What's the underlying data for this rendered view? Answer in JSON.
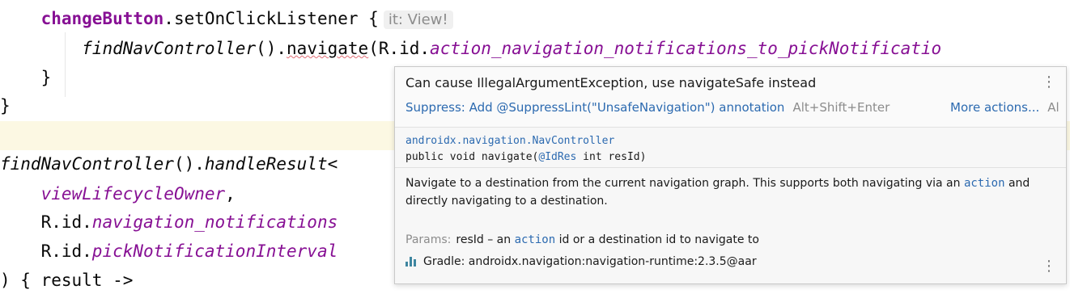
{
  "code": {
    "line1": {
      "receiver": "changeButton",
      "call": ".setOnClickListener {",
      "hint": "it: View!"
    },
    "line2": {
      "fn": "findNavController",
      "pre": "().",
      "method": "navigate",
      "open": "(R.id.",
      "arg": "action_navigation_notifications_to_pickNotificatio"
    },
    "line3": "}",
    "line4": "}",
    "line6": {
      "fn": "findNavController",
      "mid": "().",
      "method": "handleResult",
      "tail": "<"
    },
    "line7": {
      "arg": "viewLifecycleOwner",
      "tail": ","
    },
    "line8": {
      "pre": "R.id.",
      "arg": "navigation_notifications"
    },
    "line9": {
      "pre": "R.id.",
      "arg": "pickNotificationInterval"
    },
    "line10": ") { result ->"
  },
  "popup": {
    "message": "Can cause IllegalArgumentException, use navigateSafe instead",
    "suppress_label": "Suppress: Add @SuppressLint(\"UnsafeNavigation\") annotation",
    "suppress_shortcut": "Alt+Shift+Enter",
    "more_actions": "More actions...",
    "more_shortcut": "Al",
    "menu_glyph": "⋮",
    "signature": {
      "package": "androidx.navigation.NavController",
      "decl_pre": "public void navigate(",
      "annotation": "@IdRes",
      "decl_post": " int resId)"
    },
    "doc": {
      "text1": "Navigate to a destination from the current navigation graph. This supports both navigating via an ",
      "code": "action",
      "text2": " and directly navigating to a destination."
    },
    "params": {
      "label": "Params:",
      "name": "resId",
      "dash": " – an ",
      "code": "action",
      "rest": " id or a destination id to navigate to"
    },
    "gradle": "Gradle: androidx.navigation:navigation-runtime:2.3.5@aar"
  }
}
